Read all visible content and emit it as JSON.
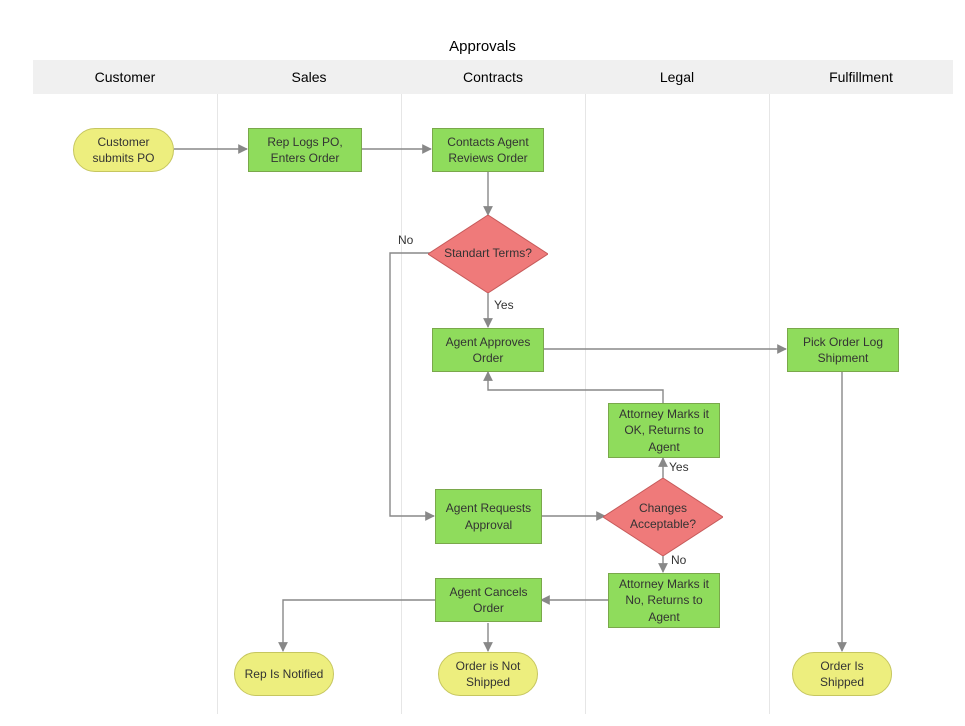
{
  "title": "Approvals",
  "lanes": {
    "customer": "Customer",
    "sales": "Sales",
    "contracts": "Contracts",
    "legal": "Legal",
    "fulfillment": "Fulfillment"
  },
  "nodes": {
    "customer_submits_po": "Customer\nsubmits PO",
    "rep_logs_po": "Rep Logs PO,\nEnters Order",
    "contacts_agent_reviews": "Contacts Agent\nReviews Order",
    "standard_terms": "Standart Terms?",
    "agent_approves_order": "Agent Approves\nOrder",
    "pick_order_log_shipment": "Pick Order\nLog Shipment",
    "attorney_marks_ok": "Attorney\nMarks it OK,\nReturns to Agent",
    "agent_requests_approval": "Agent\nRequests\nApproval",
    "changes_acceptable": "Changes\nAcceptable?",
    "agent_cancels_order": "Agent Cancels\nOrder",
    "attorney_marks_no": "Attorney\nMarks it No,\nReturns to Agent",
    "rep_is_notified": "Rep Is\nNotified",
    "order_not_shipped": "Order is\nNot Shipped",
    "order_is_shipped": "Order Is\nShipped"
  },
  "labels": {
    "no1": "No",
    "yes1": "Yes",
    "yes2": "Yes",
    "no2": "No"
  },
  "colors": {
    "process_fill": "#8fdc5c",
    "decision_fill": "#ef7a7a",
    "terminator_fill": "#edee7e",
    "lane_header_bg": "#f0f0f0",
    "edge": "#888888"
  }
}
